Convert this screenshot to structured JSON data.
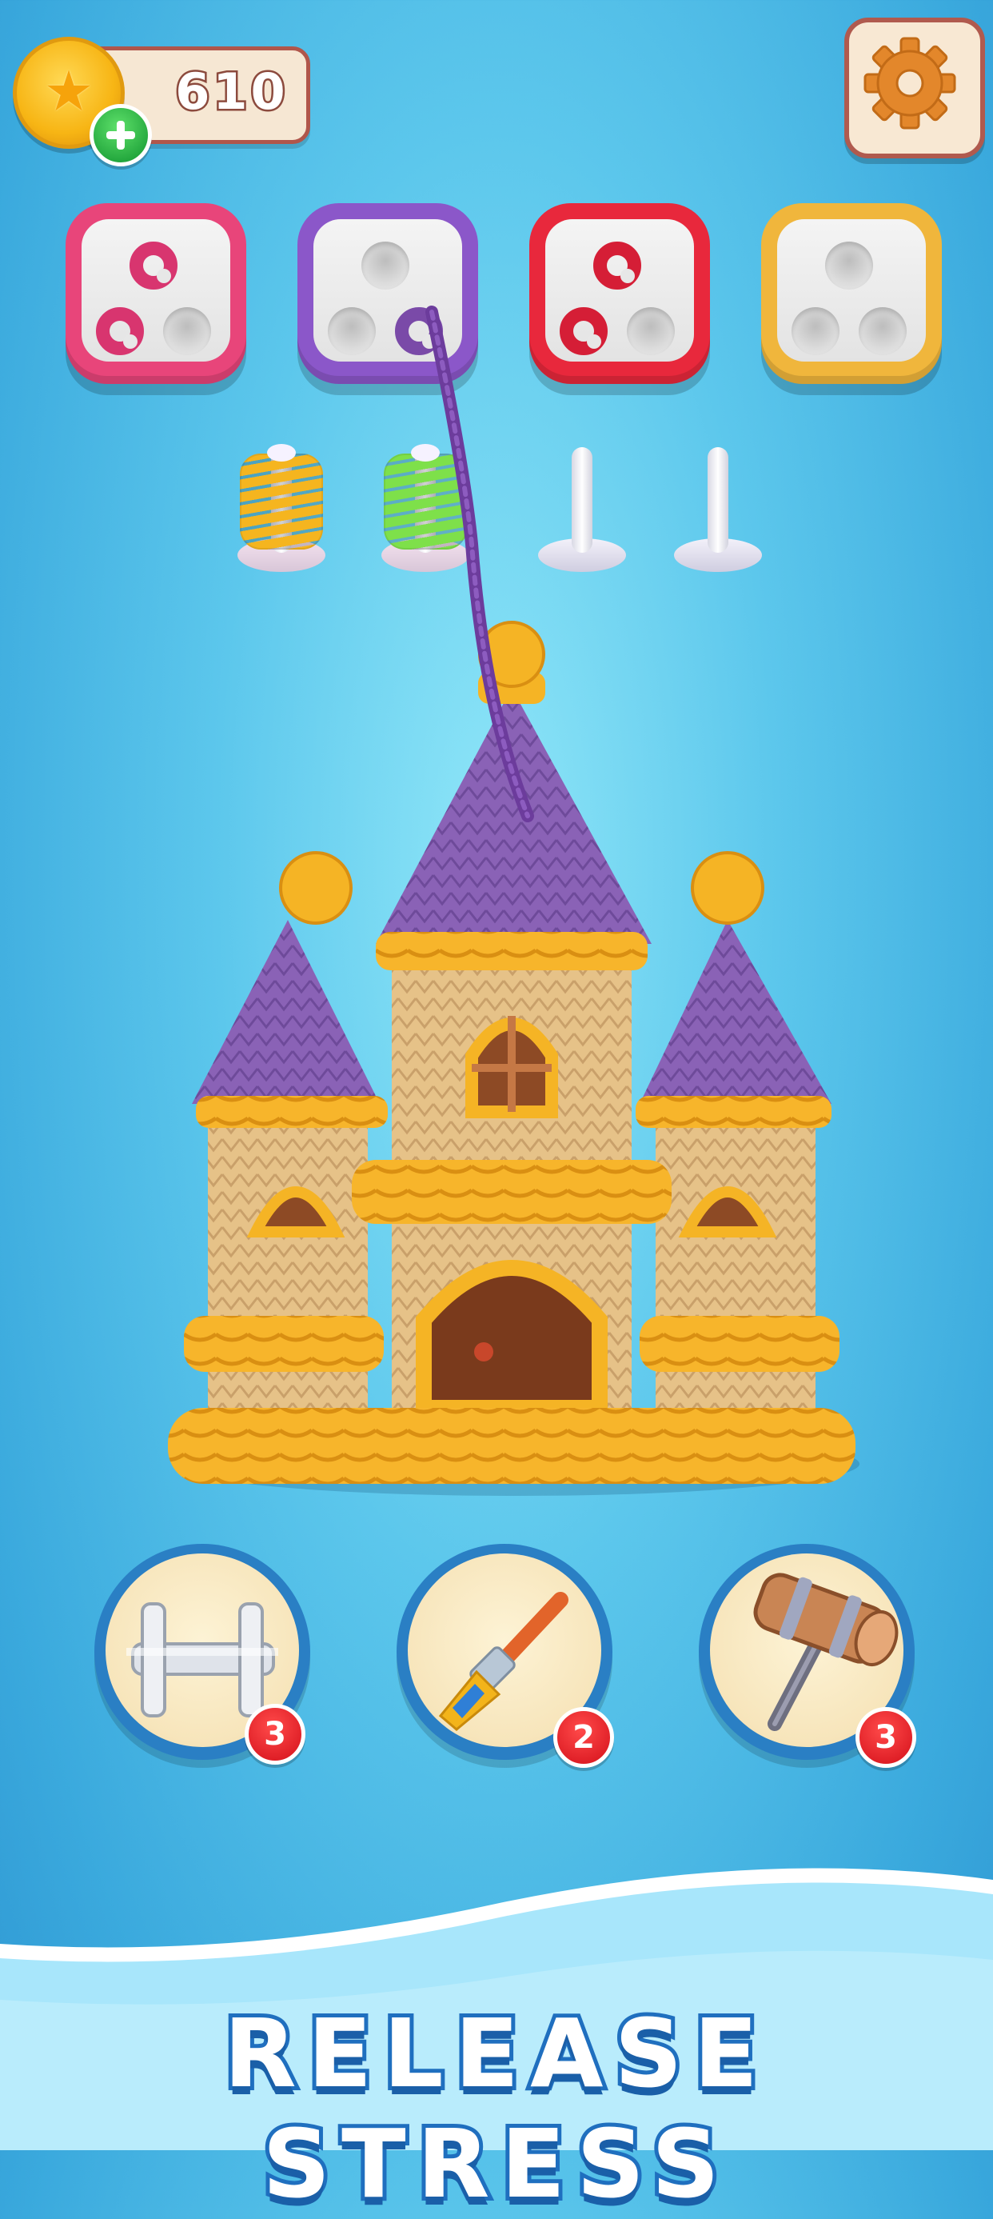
{
  "hud": {
    "coins": "610",
    "coin_icon": "star-coin-icon",
    "add_icon": "plus-icon",
    "settings_icon": "gear-icon"
  },
  "color_boxes": [
    {
      "frame_color": "#e8457a",
      "holes": [
        "#d8356f",
        "#d8356f",
        null
      ]
    },
    {
      "frame_color": "#8b57c9",
      "holes": [
        null,
        null,
        "#7a4aa8"
      ]
    },
    {
      "frame_color": "#e8283c",
      "holes": [
        "#d51e36",
        "#d51e36",
        null
      ]
    },
    {
      "frame_color": "#f0b63c",
      "holes": [
        null,
        null,
        null
      ]
    }
  ],
  "spools": [
    {
      "color": "#f5b51f",
      "filled": true
    },
    {
      "color": "#7ee04a",
      "filled": true
    },
    {
      "color": null,
      "filled": false
    },
    {
      "color": null,
      "filled": false
    }
  ],
  "artwork": {
    "subject": "knitted-castle-icon",
    "yarn_color": "#6c3c9c",
    "wall_color": "#e7c48a",
    "trim_color": "#f5b425",
    "roof_color": "#8a63b5"
  },
  "tools": [
    {
      "name": "pipe-connector-icon",
      "count": "3"
    },
    {
      "name": "paint-brush-icon",
      "count": "2"
    },
    {
      "name": "hammer-icon",
      "count": "3"
    }
  ],
  "footer": {
    "tagline": "RELEASE STRESS"
  }
}
